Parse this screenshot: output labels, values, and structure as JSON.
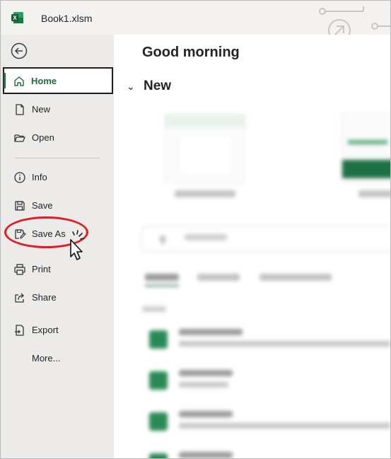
{
  "window": {
    "title": "Book1.xlsm"
  },
  "sidebar": {
    "items": [
      {
        "key": "home",
        "label": "Home"
      },
      {
        "key": "new",
        "label": "New"
      },
      {
        "key": "open",
        "label": "Open"
      },
      {
        "key": "info",
        "label": "Info"
      },
      {
        "key": "save",
        "label": "Save"
      },
      {
        "key": "save_as",
        "label": "Save As"
      },
      {
        "key": "print",
        "label": "Print"
      },
      {
        "key": "share",
        "label": "Share"
      },
      {
        "key": "export",
        "label": "Export"
      },
      {
        "key": "more",
        "label": "More..."
      }
    ]
  },
  "main": {
    "greeting": "Good morning",
    "new_section": {
      "heading": "New"
    }
  },
  "colors": {
    "accent": "#1e7145",
    "highlight_ring": "#e31b23",
    "sidebar_bg": "#ecebe9"
  },
  "icons": [
    "excel-logo-icon",
    "back-arrow-icon",
    "home-icon",
    "new-document-icon",
    "open-folder-icon",
    "info-icon",
    "save-icon",
    "save-as-icon",
    "print-icon",
    "share-icon",
    "export-icon",
    "mouse-pointer-icon"
  ]
}
